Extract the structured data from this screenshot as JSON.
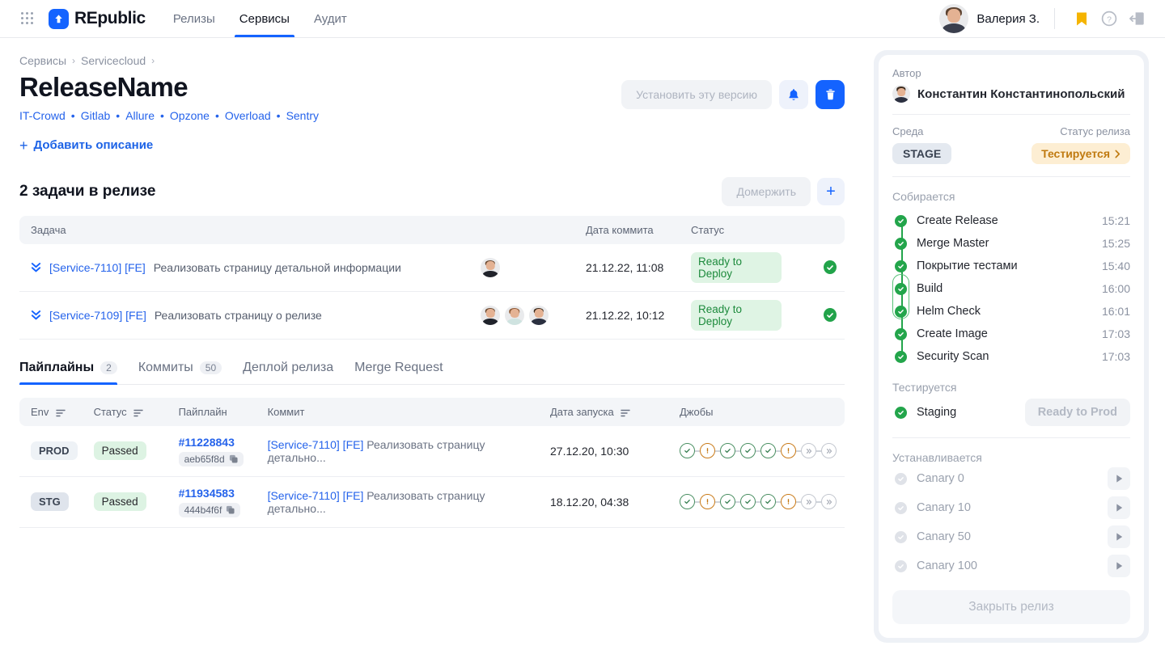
{
  "header": {
    "brand": "REpublic",
    "nav": [
      {
        "label": "Релизы",
        "active": false
      },
      {
        "label": "Сервисы",
        "active": true
      },
      {
        "label": "Аудит",
        "active": false
      }
    ],
    "user_name": "Валерия З.",
    "icons": {
      "grid": "grid-icon",
      "bookmark": "bookmark-icon",
      "help": "help-icon",
      "logout": "logout-icon"
    }
  },
  "breadcrumb": {
    "items": [
      "Сервисы",
      "Servicecloud"
    ],
    "separator": "›"
  },
  "release": {
    "title": "ReleaseName",
    "links": [
      "IT-Crowd",
      "Gitlab",
      "Allure",
      "Opzone",
      "Overload",
      "Sentry"
    ],
    "add_description": "Добавить описание",
    "install_button": "Установить эту версию"
  },
  "tasks": {
    "heading": "2 задачи в релизе",
    "merge_button": "Домержить",
    "add_button": "+",
    "columns": [
      "Задача",
      "Дата коммита",
      "Статус"
    ],
    "rows": [
      {
        "key": "[Service-7110] [FE]",
        "name": "Реализовать страницу детальной информации",
        "avatars": 1,
        "date": "21.12.22, 11:08",
        "status": "Ready to Deploy"
      },
      {
        "key": "[Service-7109] [FE]",
        "name": "Реализовать страницу о релизе",
        "avatars": 3,
        "date": "21.12.22, 10:12",
        "status": "Ready to Deploy"
      }
    ]
  },
  "tabs": [
    {
      "label": "Пайплайны",
      "count": "2",
      "active": true
    },
    {
      "label": "Коммиты",
      "count": "50",
      "active": false
    },
    {
      "label": "Деплой релиза",
      "count": "",
      "active": false
    },
    {
      "label": "Merge Request",
      "count": "",
      "active": false
    }
  ],
  "pipelines": {
    "columns": [
      "Env",
      "Статус",
      "Пайплайн",
      "Коммит",
      "Дата запуска",
      "Джобы"
    ],
    "rows": [
      {
        "env": "PROD",
        "status": "Passed",
        "pipeline_id": "#11228843",
        "hash": "aeb65f8d",
        "commit_key": "[Service-7110] [FE]",
        "commit_text": "Реализовать страницу детально...",
        "date": "27.12.20, 10:30",
        "jobs": [
          "ok",
          "warn",
          "ok",
          "ok",
          "ok",
          "warn",
          "skip",
          "skip"
        ]
      },
      {
        "env": "STG",
        "status": "Passed",
        "pipeline_id": "#11934583",
        "hash": "444b4f6f",
        "commit_key": "[Service-7110] [FE]",
        "commit_text": "Реализовать страницу детально...",
        "date": "18.12.20, 04:38",
        "jobs": [
          "ok",
          "warn",
          "ok",
          "ok",
          "ok",
          "warn",
          "skip",
          "skip"
        ]
      }
    ]
  },
  "sidebar": {
    "author_label": "Автор",
    "author_name": "Константин Константинопольский",
    "env_label": "Среда",
    "env_value": "STAGE",
    "status_label": "Статус релиза",
    "status_value": "Тестируется",
    "build_section": "Собирается",
    "build_steps": [
      {
        "name": "Create Release",
        "time": "15:21"
      },
      {
        "name": "Merge Master",
        "time": "15:25"
      },
      {
        "name": "Покрытие тестами",
        "time": "15:40"
      },
      {
        "name": "Build",
        "time": "16:00"
      },
      {
        "name": "Helm Check",
        "time": "16:01"
      },
      {
        "name": "Create Image",
        "time": "17:03"
      },
      {
        "name": "Security Scan",
        "time": "17:03"
      }
    ],
    "testing_section": "Тестируется",
    "testing_step": "Staging",
    "ready_to_prod": "Ready to Prod",
    "installing_section": "Устанавливается",
    "canary_steps": [
      {
        "name": "Canary 0"
      },
      {
        "name": "Canary 10"
      },
      {
        "name": "Canary 50"
      },
      {
        "name": "Canary 100"
      }
    ],
    "close_release": "Закрыть релиз"
  },
  "colors": {
    "brand_blue": "#1463ff",
    "link_blue": "#2563eb",
    "green": "#22a34a",
    "orange": "#c07a10"
  }
}
